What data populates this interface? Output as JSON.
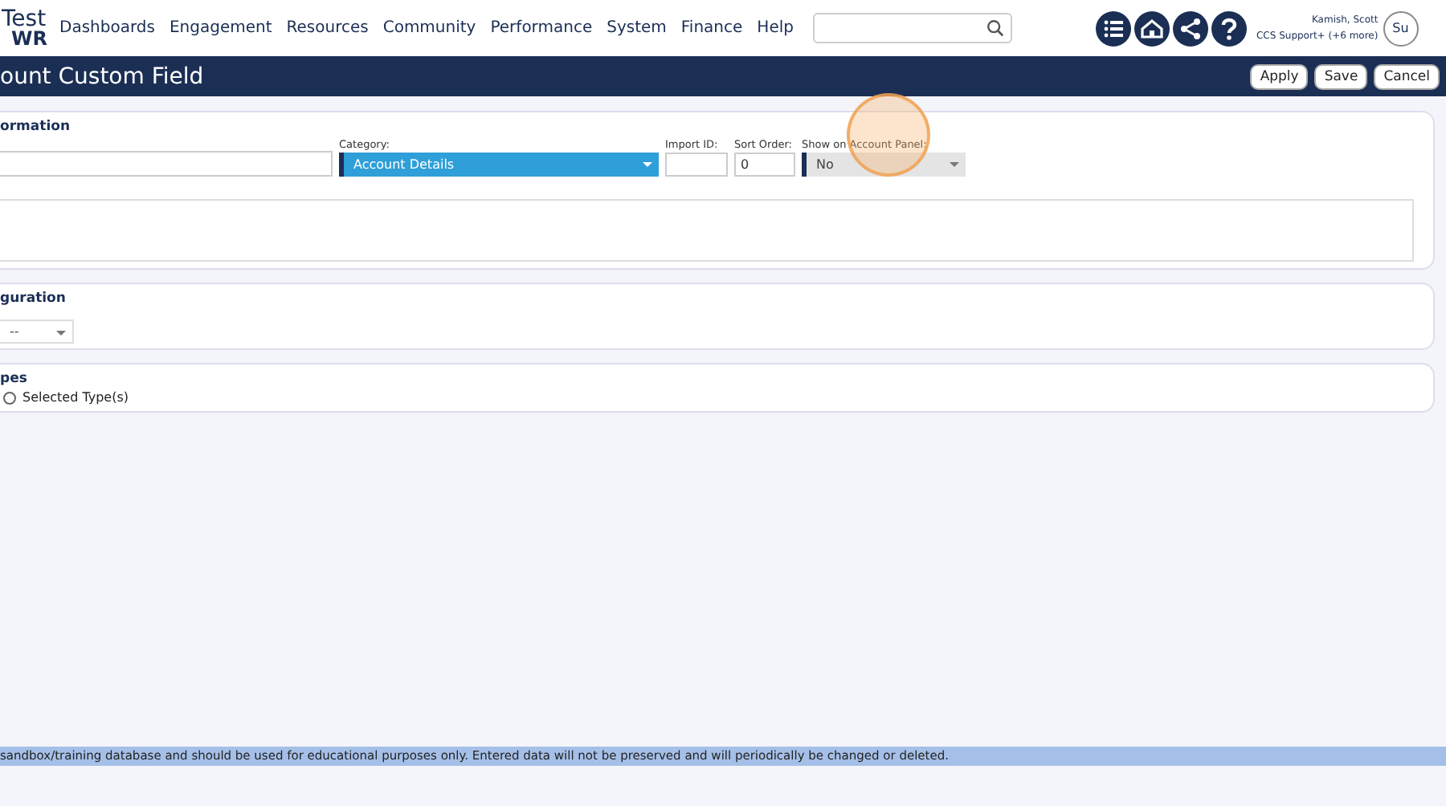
{
  "logo": {
    "line1": "Test",
    "line2": "WR"
  },
  "nav": [
    "Dashboards",
    "Engagement",
    "Resources",
    "Community",
    "Performance",
    "System",
    "Finance",
    "Help"
  ],
  "user": {
    "name": "Kamish, Scott",
    "role": "CCS Support+ (+6 more)",
    "avatar_text": "Su"
  },
  "title": "ount Custom Field",
  "actions": [
    "Apply",
    "Save",
    "Cancel"
  ],
  "info_section": {
    "heading": "ormation",
    "category": {
      "label": "Category:",
      "value": "Account Details"
    },
    "import_id": {
      "label": "Import ID:"
    },
    "sort_order": {
      "label": "Sort Order:",
      "value": "0"
    },
    "show_on_panel": {
      "label": "Show on Account Panel:",
      "value": "No"
    }
  },
  "config_section": {
    "heading": "guration",
    "select_value": "--"
  },
  "types_section": {
    "heading": "pes",
    "options": [
      {
        "label": "Selected Type(s)",
        "selected": false
      }
    ]
  },
  "click_highlight": true,
  "footer_notice": "sandbox/training database and should be used for educational purposes only. Entered data will not be preserved and will periodically be changed or deleted."
}
